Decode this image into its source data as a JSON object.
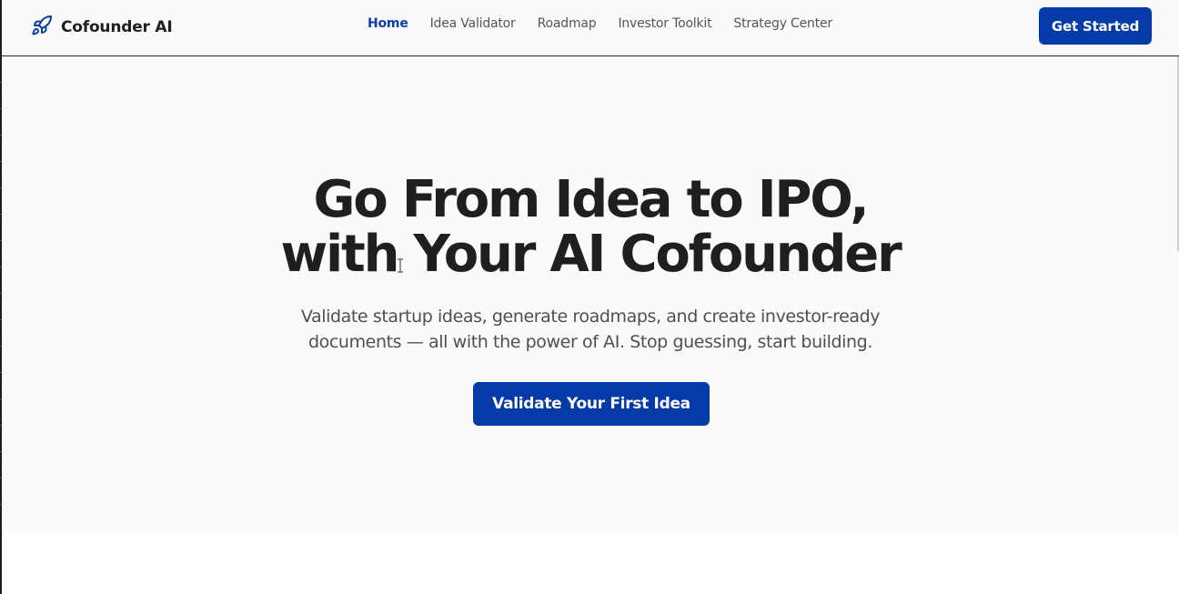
{
  "header": {
    "brand_name": "Cofounder AI",
    "brand_icon": "rocket-icon",
    "nav": [
      {
        "label": "Home",
        "active": true
      },
      {
        "label": "Idea Validator",
        "active": false
      },
      {
        "label": "Roadmap",
        "active": false
      },
      {
        "label": "Investor Toolkit",
        "active": false
      },
      {
        "label": "Strategy Center",
        "active": false
      }
    ],
    "cta_label": "Get Started"
  },
  "hero": {
    "title_line1": "Go From Idea to IPO,",
    "title_line2": "with Your AI Cofounder",
    "subtitle": "Validate startup ideas, generate roadmaps, and create investor-ready documents — all with the power of AI. Stop guessing, start building.",
    "cta_label": "Validate Your First Idea"
  },
  "colors": {
    "accent": "#063aa8",
    "active_nav": "#0b3ea8",
    "background": "#fafafa",
    "heading": "#1f1f1f",
    "body_text": "#4f4f4f"
  }
}
